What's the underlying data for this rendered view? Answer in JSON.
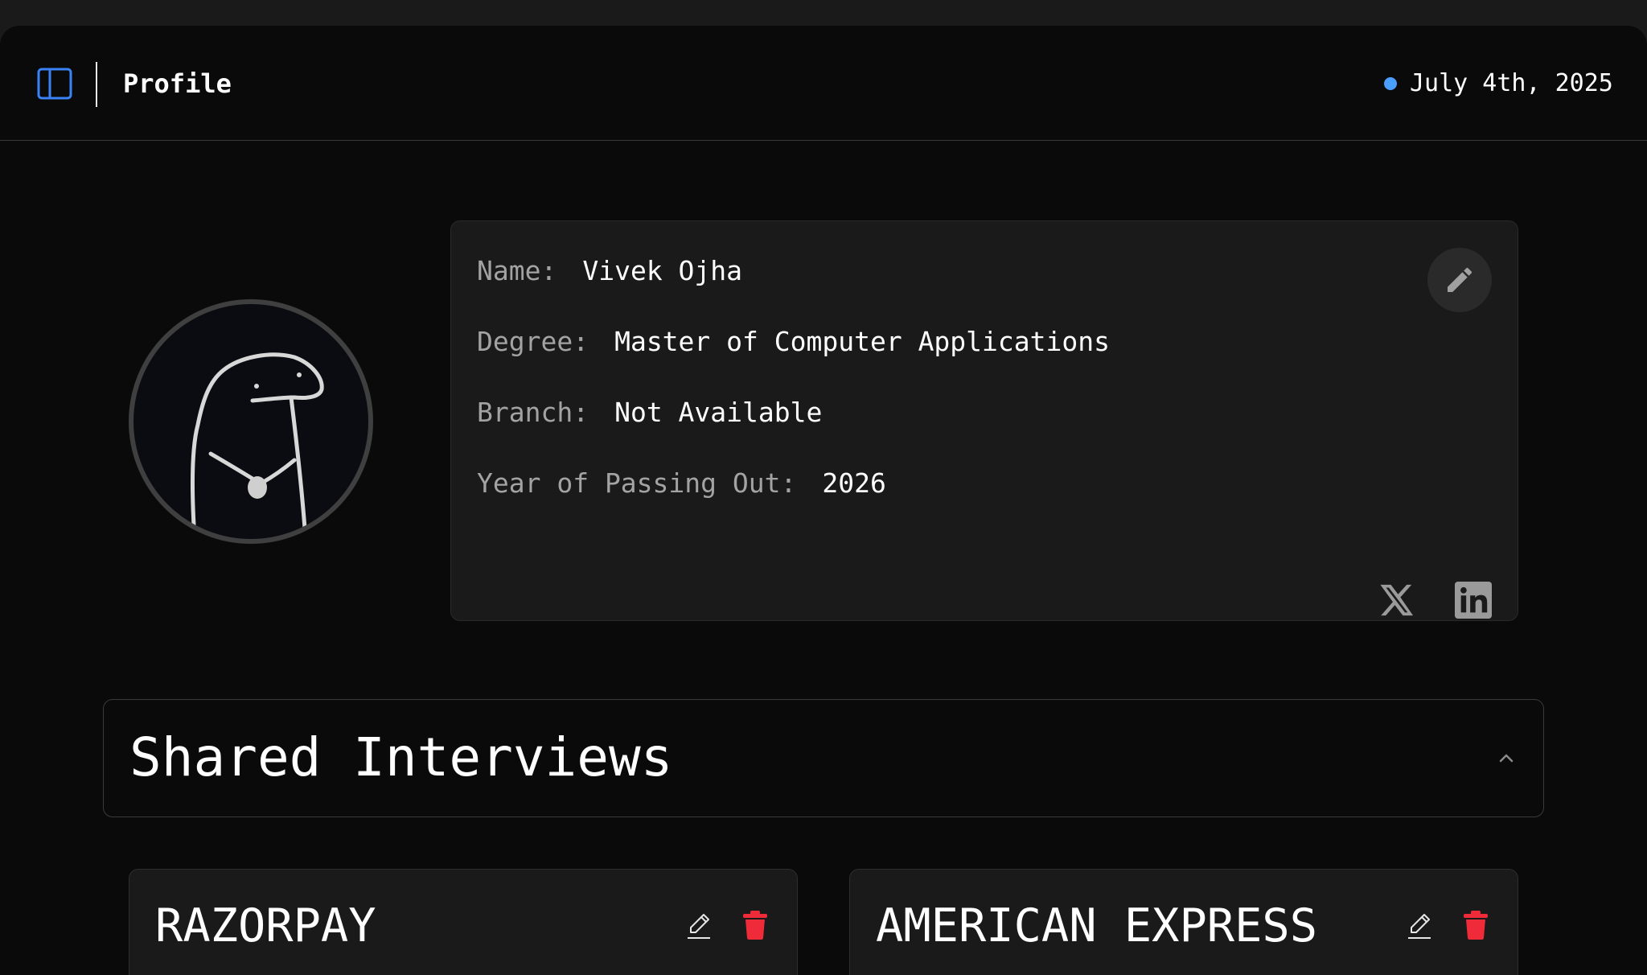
{
  "header": {
    "title": "Profile",
    "date": "July 4th, 2025",
    "status_color": "#4a9eff",
    "accent_color": "#3b82f6"
  },
  "profile": {
    "fields": [
      {
        "label": "Name:",
        "value": "Vivek Ojha"
      },
      {
        "label": "Degree:",
        "value": "Master of Computer Applications"
      },
      {
        "label": "Branch:",
        "value": "Not Available"
      },
      {
        "label": "Year of Passing Out:",
        "value": "2026"
      }
    ],
    "edit_icon": "pencil-icon",
    "social_icons": [
      "x-icon",
      "linkedin-icon"
    ]
  },
  "shared_interviews": {
    "title": "Shared Interviews",
    "collapse_icon": "chevron-up-icon",
    "cards": [
      {
        "company": "RAZORPAY"
      },
      {
        "company": "AMERICAN EXPRESS"
      }
    ],
    "delete_color": "#ef2b3a"
  }
}
